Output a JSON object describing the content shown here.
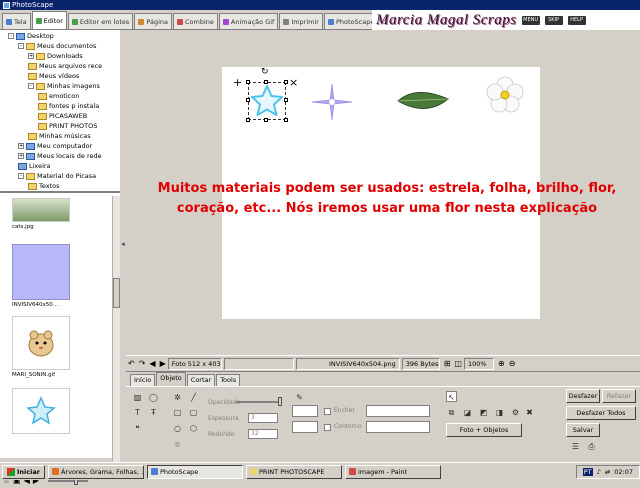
{
  "window": {
    "title": "PhotoScape"
  },
  "tabs": [
    {
      "label": "Tela",
      "color": "#4a7fd0"
    },
    {
      "label": "Editor",
      "color": "#4aa04a"
    },
    {
      "label": "Editor em lotes",
      "color": "#4aa04a"
    },
    {
      "label": "Página",
      "color": "#d08a30"
    },
    {
      "label": "Combine",
      "color": "#d04a4a"
    },
    {
      "label": "Animação Gif",
      "color": "#a04ad0"
    },
    {
      "label": "Imprimir",
      "color": "#808080"
    },
    {
      "label": "PhotoScape",
      "color": "#4a7fd0"
    }
  ],
  "banner": {
    "text": "Marcia Magal Scraps",
    "badges": [
      "MENU",
      "SKIP",
      "HELP"
    ]
  },
  "tree": [
    {
      "label": "Desktop",
      "level": 0,
      "expander": "-",
      "special": true
    },
    {
      "label": "Meus documentos",
      "level": 1,
      "expander": "-"
    },
    {
      "label": "Downloads",
      "level": 2,
      "expander": "+"
    },
    {
      "label": "Meus arquivos rece",
      "level": 2,
      "expander": ""
    },
    {
      "label": "Meus vídeos",
      "level": 2,
      "expander": ""
    },
    {
      "label": "Minhas imagens",
      "level": 2,
      "expander": "-"
    },
    {
      "label": "emoticon",
      "level": 3,
      "expander": ""
    },
    {
      "label": "fontes p instala",
      "level": 3,
      "expander": ""
    },
    {
      "label": "PICASAWEB",
      "level": 3,
      "expander": ""
    },
    {
      "label": "PRINT PHOTOS",
      "level": 3,
      "expander": ""
    },
    {
      "label": "Minhas músicas",
      "level": 2,
      "expander": ""
    },
    {
      "label": "Meu computador",
      "level": 1,
      "expander": "+",
      "special": true
    },
    {
      "label": "Meus locais de rede",
      "level": 1,
      "expander": "+",
      "special": true
    },
    {
      "label": "Lixeira",
      "level": 1,
      "expander": "",
      "special": true
    },
    {
      "label": "Material do Picasa",
      "level": 1,
      "expander": "-"
    },
    {
      "label": "Textos",
      "level": 2,
      "expander": ""
    }
  ],
  "thumbnails": [
    {
      "caption": "cats.jpg"
    },
    {
      "caption": "INVISIV640x50..."
    },
    {
      "caption": "MARI_SONIN.gif"
    },
    {
      "caption": ""
    }
  ],
  "canvas": {
    "message": "Muitos materiais podem ser usados: estrela, folha, brilho, flor, coração, etc... Nós iremos usar uma flor nesta explicação",
    "message_color": "#e00000"
  },
  "statusbar": {
    "photo_size": "Foto 512 x 403",
    "filename": "INVISIV640x504.png",
    "filesize": "396 Bytes",
    "zoom": "100%"
  },
  "panel_tabs": [
    "Início",
    "Objeto",
    "Cortar",
    "Tools"
  ],
  "active_panel_tab": "Objeto",
  "object_panel": {
    "opacity_label": "Opacidade",
    "thickness_label": "Espessura",
    "thickness_value": "3",
    "radius_label": "Redondo",
    "radius_value": "32",
    "fill_label": "Encher",
    "outline_label": "Contorno",
    "photo_objects_button": "Foto + Objetos"
  },
  "actions": {
    "undo": "Desfazer",
    "redo": "Refazer",
    "undo_all": "Desfazer Todos",
    "save": "Salvar"
  },
  "taskbar": {
    "start": "Iniciar",
    "items": [
      {
        "label": "Árvores, Grama, Folhas, ...",
        "color": "#e07020"
      },
      {
        "label": "PhotoScape",
        "color": "#4a7fd0",
        "active": true
      },
      {
        "label": "PRINT PHOTOSCAPE",
        "color": "#f2d26b"
      },
      {
        "label": "imagem - Paint",
        "color": "#d04a4a"
      }
    ],
    "lang": "PT",
    "clock": "02:07"
  }
}
